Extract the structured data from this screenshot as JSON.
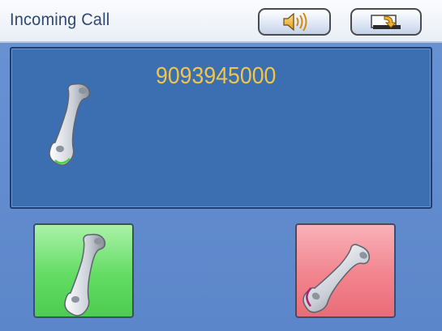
{
  "header": {
    "title": "Incoming Call",
    "speaker_button": {
      "icon": "speaker-icon"
    },
    "switch_button": {
      "icon": "switch-window-icon"
    }
  },
  "call": {
    "number": "9093945000",
    "status_icon": "handset-icon"
  },
  "actions": {
    "accept": {
      "icon": "handset-icon",
      "color": "#5fd95f"
    },
    "decline": {
      "icon": "hang-up-handset-icon",
      "color": "#f08090"
    }
  },
  "colors": {
    "background": "#5b86c9",
    "panel": "#3c6fb1",
    "number_text": "#f0c64a",
    "title_text": "#2f4a6e"
  }
}
